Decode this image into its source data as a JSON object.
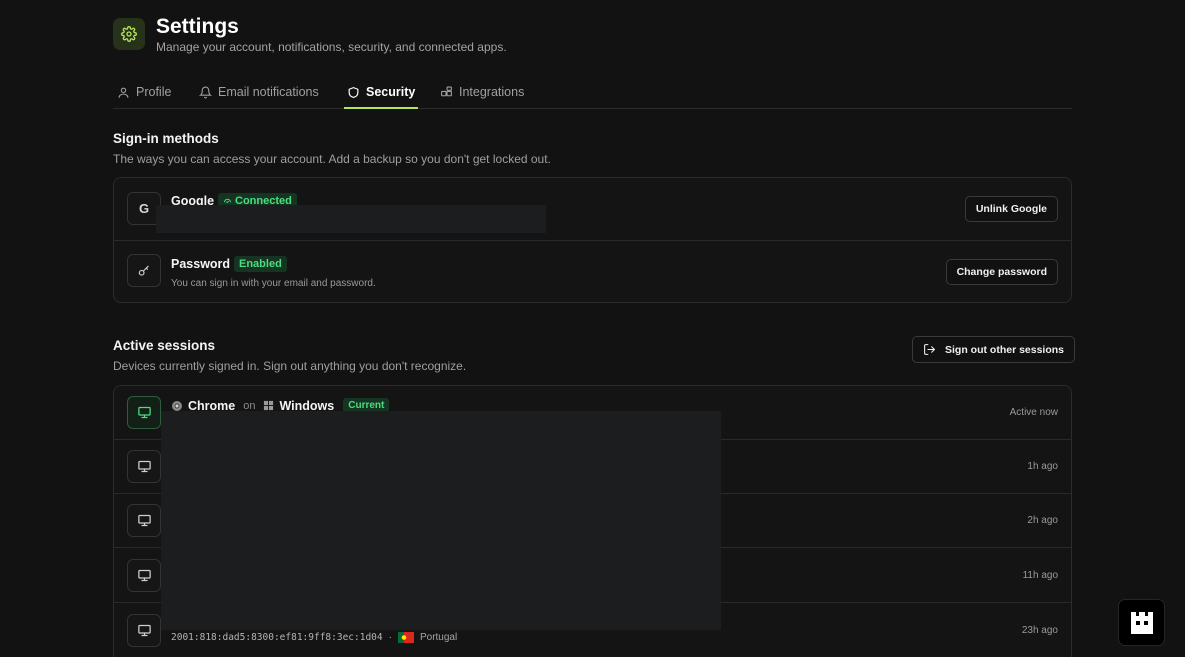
{
  "header": {
    "title": "Settings",
    "subtitle": "Manage your account, notifications, security, and connected apps.",
    "icon": "gear-icon",
    "accent": "#b5e35c"
  },
  "tabs": [
    {
      "label": "Profile",
      "icon": "user-icon",
      "active": false
    },
    {
      "label": "Email notifications",
      "icon": "bell-icon",
      "active": false
    },
    {
      "label": "Security",
      "icon": "shield-icon",
      "active": true
    },
    {
      "label": "Integrations",
      "icon": "puzzle-icon",
      "active": false
    }
  ],
  "signin": {
    "title": "Sign-in methods",
    "subtitle": "The ways you can access your account. Add a backup so you don't get locked out.",
    "methods": [
      {
        "icon_text": "G",
        "name": "Google",
        "badge": "Connected",
        "description": "",
        "button": "Unlink Google"
      },
      {
        "icon_text": "",
        "name": "Password",
        "badge": "Enabled",
        "description": "You can sign in with your email and password.",
        "button": "Change password"
      }
    ]
  },
  "sessions": {
    "title": "Active sessions",
    "subtitle": "Devices currently signed in. Sign out anything you don't recognize.",
    "signout_button": "Sign out other sessions",
    "current": {
      "browser": "Chrome",
      "on": "on",
      "os": "Windows",
      "badge": "Current",
      "time": "Active now"
    },
    "others": [
      {
        "time": "1h ago"
      },
      {
        "time": "2h ago"
      },
      {
        "time": "11h ago"
      },
      {
        "time": "23h ago",
        "ip": "2001:818:dad5:8300:ef81:9ff8:3ec:1d04",
        "separator": "·",
        "country": "Portugal"
      }
    ]
  },
  "colors": {
    "background": "#121212",
    "badge_green": "#4ade80",
    "badge_bg": "#163422"
  }
}
